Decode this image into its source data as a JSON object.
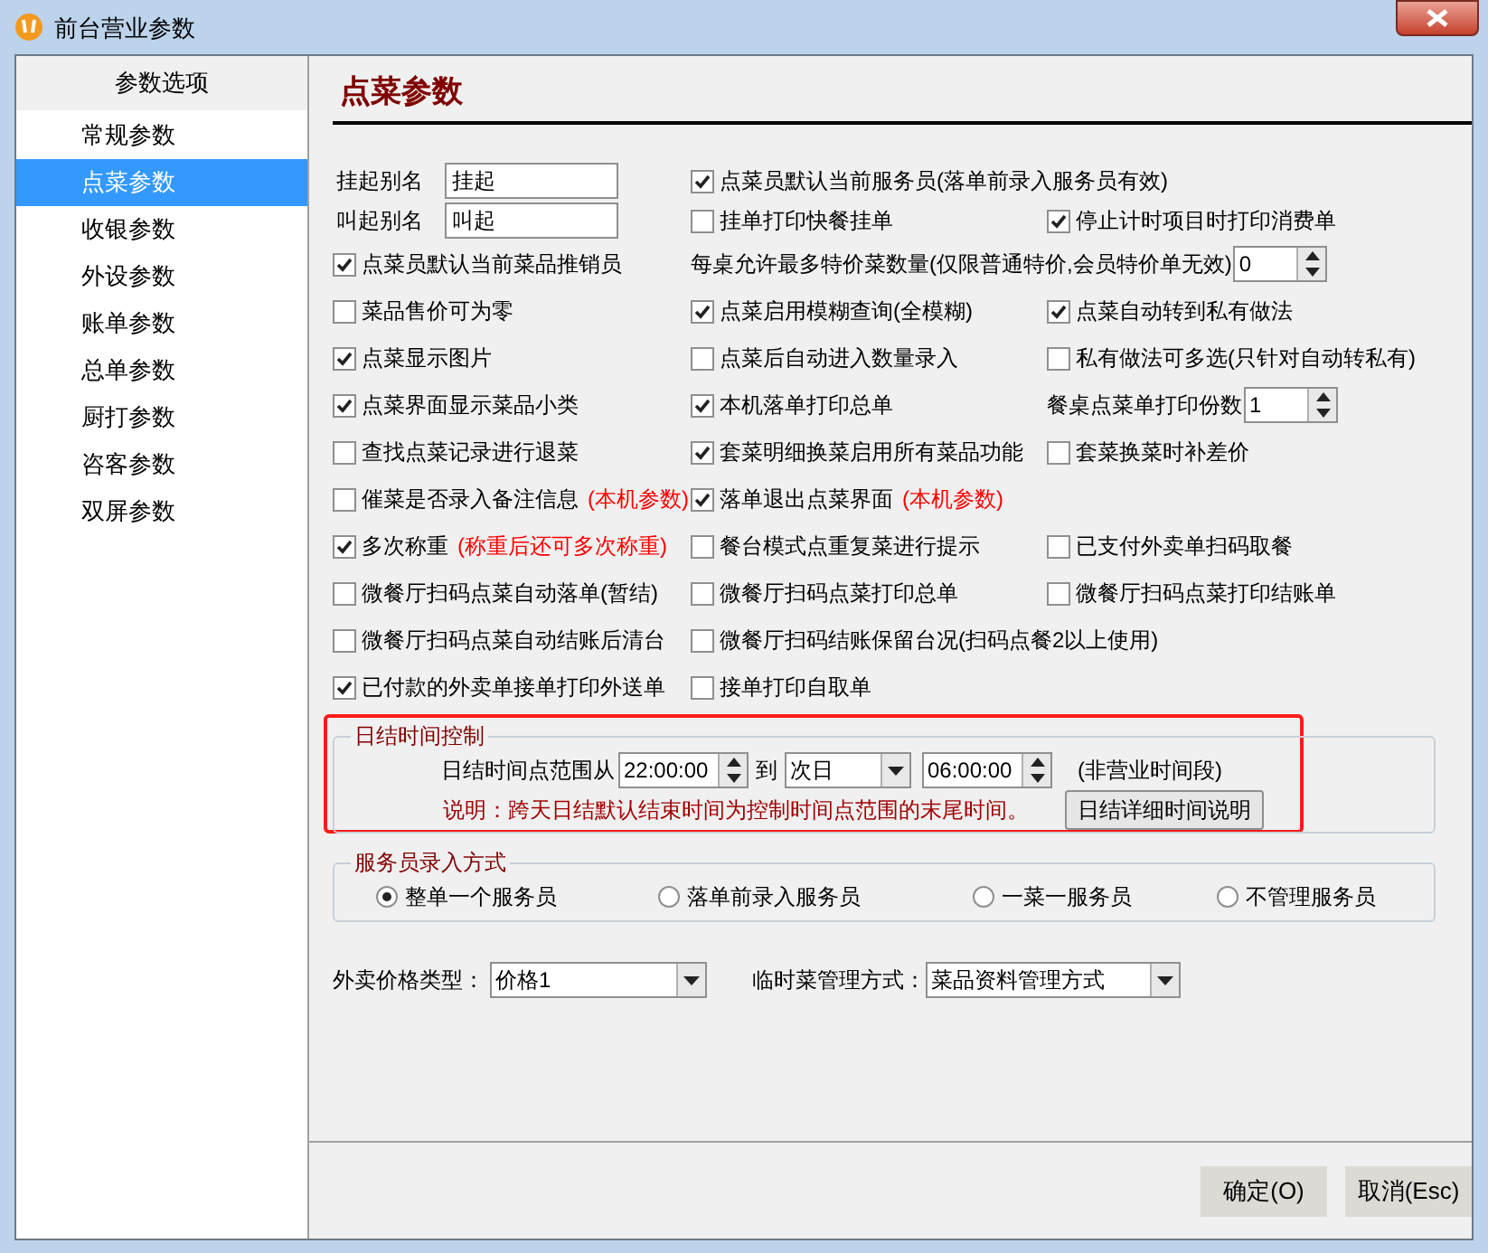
{
  "window": {
    "title": "前台营业参数"
  },
  "sidebar": {
    "header": "参数选项",
    "items": [
      {
        "label": "常规参数",
        "selected": false
      },
      {
        "label": "点菜参数",
        "selected": true
      },
      {
        "label": "收银参数",
        "selected": false
      },
      {
        "label": "外设参数",
        "selected": false
      },
      {
        "label": "账单参数",
        "selected": false
      },
      {
        "label": "总单参数",
        "selected": false
      },
      {
        "label": "厨打参数",
        "selected": false
      },
      {
        "label": "咨客参数",
        "selected": false
      },
      {
        "label": "双屏参数",
        "selected": false
      }
    ]
  },
  "panel": {
    "title": "点菜参数",
    "rows": [
      [
        {
          "kind": "field",
          "label": "挂起别名",
          "value": "挂起"
        },
        {
          "kind": "checkbox",
          "label": "点菜员默认当前服务员(落单前录入服务员有效)",
          "checked": true
        }
      ],
      [
        {
          "kind": "field",
          "label": "叫起别名",
          "value": "叫起"
        },
        {
          "kind": "checkbox",
          "label": "挂单打印快餐挂单",
          "checked": false
        },
        {
          "kind": "checkbox",
          "label": "停止计时项目时打印消费单",
          "checked": true
        }
      ],
      [
        {
          "kind": "checkbox",
          "label": "点菜员默认当前菜品推销员",
          "checked": true
        },
        {
          "kind": "wide_spin",
          "label": "每桌允许最多特价菜数量(仅限普通特价,会员特价单无效)",
          "value": "0"
        }
      ],
      [
        {
          "kind": "checkbox",
          "label": "菜品售价可为零",
          "checked": false
        },
        {
          "kind": "checkbox",
          "label": "点菜启用模糊查询(全模糊)",
          "checked": true
        },
        {
          "kind": "checkbox",
          "label": "点菜自动转到私有做法",
          "checked": true
        }
      ],
      [
        {
          "kind": "checkbox",
          "label": "点菜显示图片",
          "checked": true
        },
        {
          "kind": "checkbox",
          "label": "点菜后自动进入数量录入",
          "checked": false
        },
        {
          "kind": "checkbox",
          "label": "私有做法可多选(只针对自动转私有)",
          "checked": false
        }
      ],
      [
        {
          "kind": "checkbox",
          "label": "点菜界面显示菜品小类",
          "checked": true
        },
        {
          "kind": "checkbox",
          "label": "本机落单打印总单",
          "checked": true
        },
        {
          "kind": "spin",
          "label": "餐桌点菜单打印份数",
          "value": "1"
        }
      ],
      [
        {
          "kind": "checkbox",
          "label": "查找点菜记录进行退菜",
          "checked": false
        },
        {
          "kind": "checkbox",
          "label": "套菜明细换菜启用所有菜品功能",
          "checked": true
        },
        {
          "kind": "checkbox",
          "label": "套菜换菜时补差价",
          "checked": false
        }
      ],
      [
        {
          "kind": "checkbox",
          "label": "催菜是否录入备注信息",
          "note": "(本机参数)",
          "checked": false
        },
        {
          "kind": "checkbox",
          "label": "落单退出点菜界面",
          "note": "(本机参数)",
          "checked": true
        }
      ],
      [
        {
          "kind": "checkbox",
          "label": "多次称重",
          "note": "(称重后还可多次称重)",
          "checked": true
        },
        {
          "kind": "checkbox",
          "label": "餐台模式点重复菜进行提示",
          "checked": false
        },
        {
          "kind": "checkbox",
          "label": "已支付外卖单扫码取餐",
          "checked": false
        }
      ],
      [
        {
          "kind": "checkbox",
          "label": "微餐厅扫码点菜自动落单(暂结)",
          "checked": false
        },
        {
          "kind": "checkbox",
          "label": "微餐厅扫码点菜打印总单",
          "checked": false
        },
        {
          "kind": "checkbox",
          "label": "微餐厅扫码点菜打印结账单",
          "checked": false
        }
      ],
      [
        {
          "kind": "checkbox",
          "label": "微餐厅扫码点菜自动结账后清台",
          "checked": false
        },
        {
          "kind": "wide_check",
          "label": "微餐厅扫码结账保留台况(扫码点餐2以上使用)",
          "checked": false
        }
      ],
      [
        {
          "kind": "checkbox",
          "label": "已付款的外卖单接单打印外送单",
          "checked": true
        },
        {
          "kind": "checkbox",
          "label": "接单打印自取单",
          "checked": false
        }
      ]
    ],
    "daily_close": {
      "title": "日结时间控制",
      "highlighted": true,
      "label": "日结时间点范围从",
      "start_time": "22:00:00",
      "to_label": "到",
      "day": "次日",
      "end_time": "06:00:00",
      "hint": "(非营业时间段)",
      "note": "说明：跨天日结默认结束时间为控制时间点范围的末尾时间。",
      "button": "日结详细时间说明"
    },
    "waiter_mode": {
      "title": "服务员录入方式",
      "options": [
        {
          "label": "整单一个服务员",
          "selected": true
        },
        {
          "label": "落单前录入服务员",
          "selected": false
        },
        {
          "label": "一菜一服务员",
          "selected": false
        },
        {
          "label": "不管理服务员",
          "selected": false
        }
      ]
    },
    "takeout_price": {
      "label": "外卖价格类型：",
      "value": "价格1"
    },
    "temp_dish": {
      "label": "临时菜管理方式：",
      "value": "菜品资料管理方式"
    }
  },
  "buttons": [
    {
      "label": "确定(O)"
    },
    {
      "label": "取消(Esc)"
    }
  ]
}
